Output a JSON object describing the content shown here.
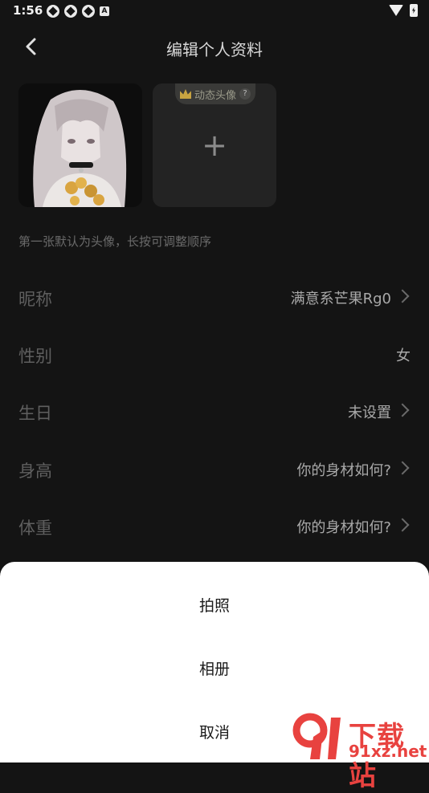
{
  "statusbar": {
    "time": "1:56",
    "badge_letter": "A"
  },
  "header": {
    "title": "编辑个人资料"
  },
  "photos": {
    "dynamic_badge": "动态头像",
    "badge_help": "?",
    "add_symbol": "+"
  },
  "hint": "第一张默认为头像，长按可调整顺序",
  "fields": [
    {
      "label": "昵称",
      "value": "满意系芒果Rg0"
    },
    {
      "label": "性别",
      "value": "女"
    },
    {
      "label": "生日",
      "value": "未设置"
    },
    {
      "label": "身高",
      "value": "你的身材如何?"
    },
    {
      "label": "体重",
      "value": "你的身材如何?"
    }
  ],
  "sheet": {
    "take_photo": "拍照",
    "album": "相册",
    "cancel": "取消"
  },
  "watermark": {
    "title": "下载站",
    "site": "91xz.net"
  },
  "colors": {
    "background": "#141414",
    "sheet": "#ffffff",
    "watermark": "#e8423f"
  }
}
